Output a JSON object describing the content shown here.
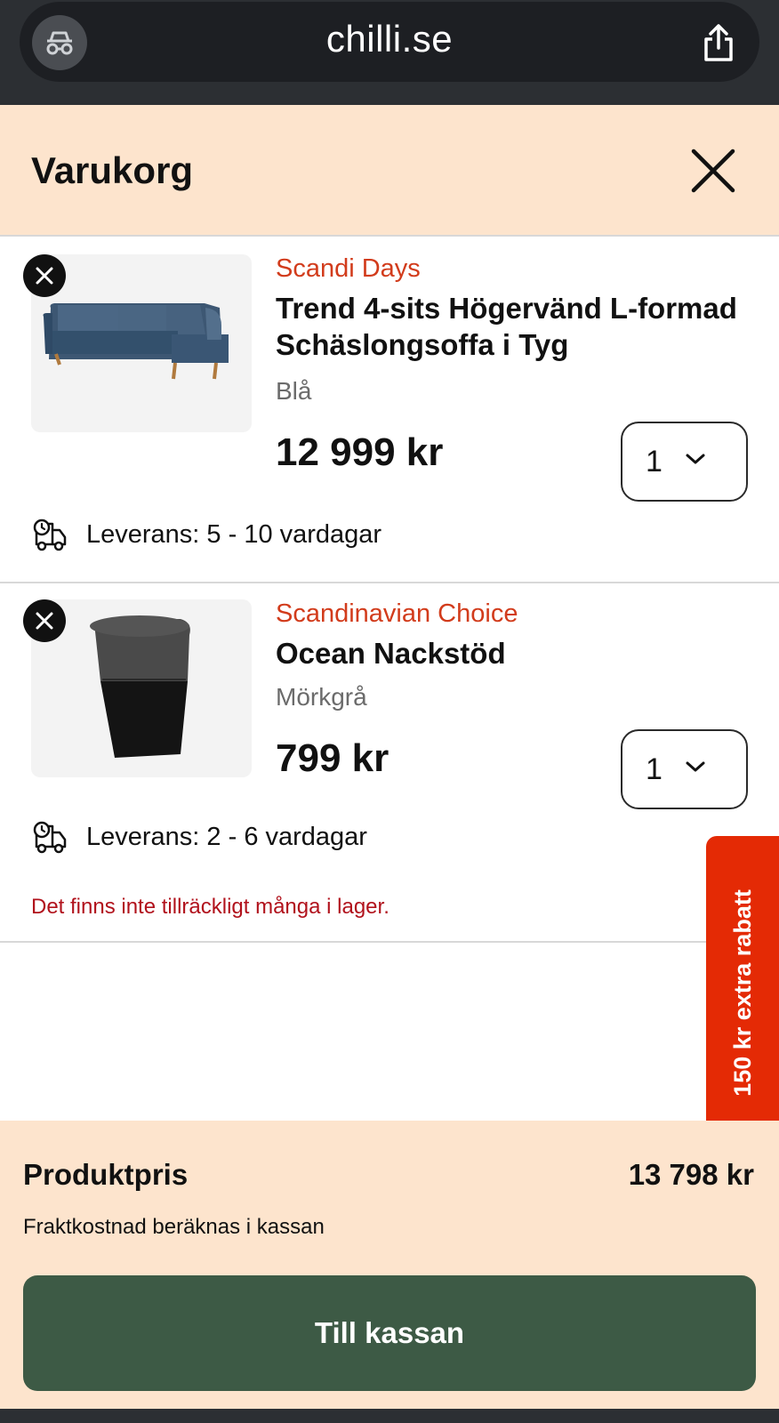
{
  "browser": {
    "url": "chilli.se",
    "incognito_icon": "incognito-icon",
    "share_icon": "share-icon"
  },
  "cart": {
    "title": "Varukorg",
    "close_icon": "close-icon"
  },
  "items": [
    {
      "brand": "Scandi Days",
      "name": "Trend 4-sits Högervänd L-formad Schäslongsoffa i Tyg",
      "variant": "Blå",
      "price": "12 999 kr",
      "quantity": "1",
      "delivery": "Leverans: 5 - 10 vardagar",
      "image": "sofa-image"
    },
    {
      "brand": "Scandinavian Choice",
      "name": "Ocean Nackstöd",
      "variant": "Mörkgrå",
      "price": "799 kr",
      "quantity": "1",
      "delivery": "Leverans: 2 - 6 vardagar",
      "warning": "Det finns inte tillräckligt många i lager.",
      "image": "headrest-image"
    }
  ],
  "promo": {
    "label": "150 kr extra rabatt"
  },
  "summary": {
    "label": "Produktpris",
    "value": "13 798 kr",
    "shipping_note": "Fraktkostnad beräknas i kassan",
    "checkout_label": "Till kassan"
  },
  "colors": {
    "header_bg": "#fde4cd",
    "brand_red": "#d23c1c",
    "warning_red": "#b1121c",
    "promo_bg": "#e42a05",
    "checkout_bg": "#3d5a45",
    "browser_bg": "#2c2f33"
  }
}
